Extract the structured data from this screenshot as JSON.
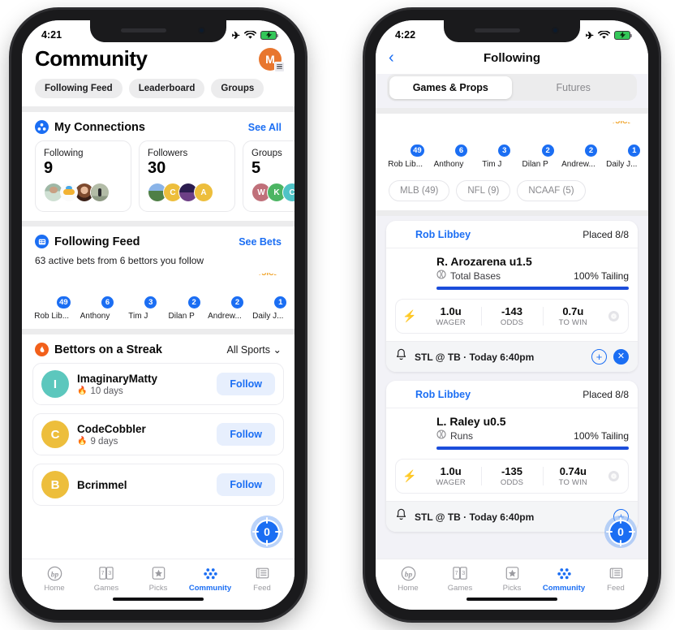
{
  "left_phone": {
    "status_bar": {
      "time": "4:21",
      "icons": [
        "airplane-mode-icon",
        "wifi-icon",
        "battery-charging-icon"
      ]
    },
    "header": {
      "title": "Community",
      "avatar_initial": "M",
      "avatar_color": "#e8762e"
    },
    "tabs": [
      {
        "label": "Following Feed"
      },
      {
        "label": "Leaderboard"
      },
      {
        "label": "Groups"
      }
    ],
    "my_connections": {
      "title": "My Connections",
      "action": "See All",
      "cards": [
        {
          "label": "Following",
          "value": "9",
          "avatars": [
            "photo",
            "photo",
            "photo",
            "photo"
          ]
        },
        {
          "label": "Followers",
          "value": "30",
          "avatars": [
            "photo",
            "C",
            "photo",
            "A"
          ]
        },
        {
          "label": "Groups",
          "value": "5",
          "avatars": [
            "W",
            "K",
            "C"
          ]
        }
      ]
    },
    "following_feed": {
      "title": "Following Feed",
      "action": "See Bets",
      "subtitle": "63 active bets from 6 bettors you follow",
      "bettors": [
        {
          "name": "Rob Lib...",
          "count": "49"
        },
        {
          "name": "Anthony",
          "count": "6"
        },
        {
          "name": "Tim J",
          "count": "3"
        },
        {
          "name": "Dilan P",
          "count": "2"
        },
        {
          "name": "Andrew...",
          "count": "2"
        },
        {
          "name": "Daily J...",
          "count": "1"
        }
      ]
    },
    "streak": {
      "title": "Bettors on a Streak",
      "filter": "All Sports",
      "items": [
        {
          "initial": "I",
          "color": "#5cc7bd",
          "name": "ImaginaryMatty",
          "days": "10 days",
          "button": "Follow"
        },
        {
          "initial": "C",
          "color": "#edbe3c",
          "name": "CodeCobbler",
          "days": "9 days",
          "button": "Follow"
        },
        {
          "initial": "B",
          "color": "#edbe3c",
          "name": "Bcrimmel",
          "days": "",
          "button": "Follow"
        }
      ]
    },
    "fab": {
      "value": "0",
      "icon": "crosshair-target-icon"
    },
    "tabbar": [
      {
        "label": "Home",
        "icon": "bp-logo-icon",
        "active": false
      },
      {
        "label": "Games",
        "icon": "cards-73-icon",
        "active": false
      },
      {
        "label": "Picks",
        "icon": "star-box-icon",
        "active": false
      },
      {
        "label": "Community",
        "icon": "dots-cluster-icon",
        "active": true
      },
      {
        "label": "Feed",
        "icon": "newspaper-icon",
        "active": false
      }
    ]
  },
  "right_phone": {
    "status_bar": {
      "time": "4:22",
      "icons": [
        "airplane-mode-icon",
        "wifi-icon",
        "battery-charging-icon"
      ]
    },
    "nav": {
      "back": "‹",
      "title": "Following"
    },
    "segments": [
      {
        "label": "Games & Props",
        "active": true
      },
      {
        "label": "Futures",
        "active": false
      }
    ],
    "bettors": [
      {
        "name": "Rob Lib...",
        "count": "49"
      },
      {
        "name": "Anthony",
        "count": "6"
      },
      {
        "name": "Tim J",
        "count": "3"
      },
      {
        "name": "Dilan P",
        "count": "2"
      },
      {
        "name": "Andrew...",
        "count": "2"
      },
      {
        "name": "Daily J...",
        "count": "1"
      }
    ],
    "league_chips": [
      {
        "label": "MLB",
        "count": "(49)"
      },
      {
        "label": "NFL",
        "count": "(9)"
      },
      {
        "label": "NCAAF",
        "count": "(5)"
      }
    ],
    "bets": [
      {
        "user": "Rob Libbey",
        "placed": "Placed 8/8",
        "line": "R. Arozarena u1.5",
        "market": "Total Bases",
        "tailing": "100% Tailing",
        "progress_pct": 100,
        "wager_value": "1.0u",
        "wager_label": "WAGER",
        "odds_value": "-143",
        "odds_label": "ODDS",
        "towin_value": "0.7u",
        "towin_label": "TO WIN",
        "game": "STL @ TB · Today 6:40pm",
        "actions": [
          "add-icon",
          "close-icon"
        ]
      },
      {
        "user": "Rob Libbey",
        "placed": "Placed 8/8",
        "line": "L. Raley u0.5",
        "market": "Runs",
        "tailing": "100% Tailing",
        "progress_pct": 100,
        "wager_value": "1.0u",
        "wager_label": "WAGER",
        "odds_value": "-135",
        "odds_label": "ODDS",
        "towin_value": "0.74u",
        "towin_label": "TO WIN",
        "game": "STL @ TB · Today 6:40pm",
        "actions": [
          "add-icon"
        ]
      }
    ],
    "fab": {
      "value": "0",
      "icon": "crosshair-target-icon"
    },
    "tabbar": [
      {
        "label": "Home",
        "icon": "bp-logo-icon",
        "active": false
      },
      {
        "label": "Games",
        "icon": "cards-73-icon",
        "active": false
      },
      {
        "label": "Picks",
        "icon": "star-box-icon",
        "active": false
      },
      {
        "label": "Community",
        "icon": "dots-cluster-icon",
        "active": true
      },
      {
        "label": "Feed",
        "icon": "newspaper-icon",
        "active": false
      }
    ]
  },
  "colors": {
    "accent": "#1b6ef3",
    "orange": "#e8762e",
    "flame": "#f2601a",
    "progress": "#1b4ddb"
  }
}
